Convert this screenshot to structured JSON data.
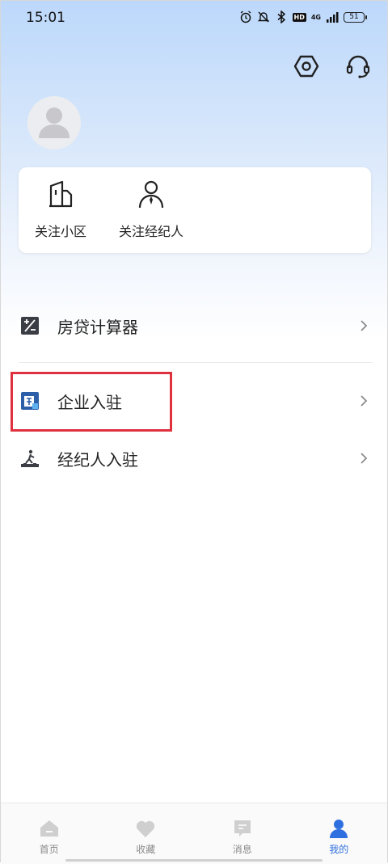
{
  "status_bar": {
    "time": "15:01",
    "network": "4G",
    "hd": "HD",
    "battery": "51"
  },
  "header": {
    "settings_icon": "settings-hexagon-icon",
    "service_icon": "headset-icon"
  },
  "profile": {
    "avatar_icon": "user-avatar-icon"
  },
  "follow_card": {
    "items": [
      {
        "label": "关注小区",
        "icon": "building-icon"
      },
      {
        "label": "关注经纪人",
        "icon": "agent-icon"
      }
    ]
  },
  "menu": {
    "items": [
      {
        "label": "房贷计算器",
        "icon": "calculator-icon"
      },
      {
        "label": "企业入驻",
        "icon": "enterprise-icon"
      },
      {
        "label": "经纪人入驻",
        "icon": "agent-join-icon"
      }
    ]
  },
  "tabbar": {
    "items": [
      {
        "label": "首页",
        "icon": "home-icon",
        "active": false
      },
      {
        "label": "收藏",
        "icon": "heart-icon",
        "active": false
      },
      {
        "label": "消息",
        "icon": "message-icon",
        "active": false
      },
      {
        "label": "我的",
        "icon": "profile-icon",
        "active": true
      }
    ]
  },
  "colors": {
    "accent": "#2f6fe0",
    "highlight": "#e0313f",
    "tab_inactive": "#cfcfcf"
  }
}
